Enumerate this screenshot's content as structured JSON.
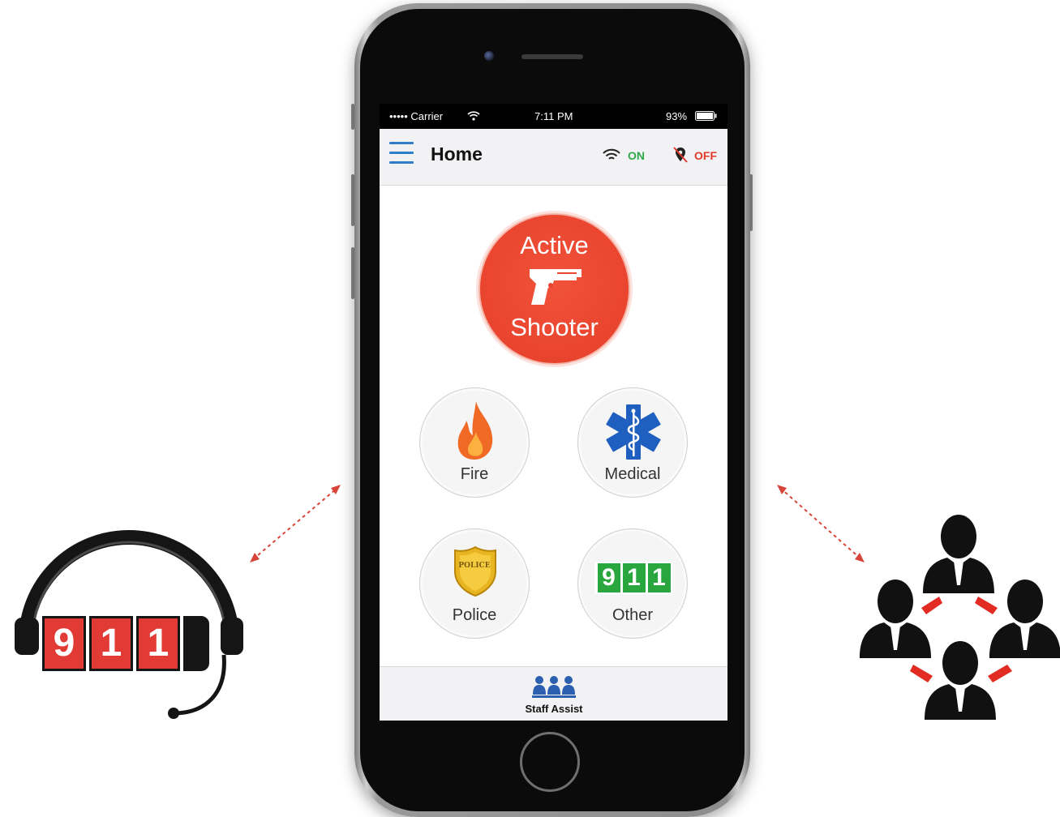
{
  "status_bar": {
    "carrier": "••••• Carrier",
    "time": "7:11 PM",
    "battery": "93%"
  },
  "nav": {
    "title": "Home",
    "wifi_label": "ON",
    "location_label": "OFF",
    "icons": {
      "menu": "menu-icon",
      "wifi": "wifi-icon",
      "location": "location-off-icon"
    }
  },
  "buttons": {
    "active_shooter": {
      "line1": "Active",
      "line2": "Shooter",
      "icon": "gun-icon"
    },
    "fire": {
      "label": "Fire",
      "icon": "flame-icon"
    },
    "medical": {
      "label": "Medical",
      "icon": "star-of-life-icon"
    },
    "police": {
      "label": "Police",
      "icon": "police-badge-icon",
      "badge_text": "POLICE"
    },
    "other": {
      "label": "Other",
      "icon": "911-icon",
      "digits": [
        "9",
        "1",
        "1"
      ]
    }
  },
  "bottom_bar": {
    "staff_assist_label": "Staff Assist",
    "icon": "staff-group-icon"
  },
  "illustrations": {
    "dispatcher_digits": [
      "9",
      "1",
      "1"
    ],
    "dispatcher_icon": "headset-911-icon",
    "staff_network_icon": "staff-network-icon"
  },
  "colors": {
    "accent_blue": "#2f7fc8",
    "alert_red": "#e9452f",
    "on_green": "#2fa84a",
    "off_red": "#e23a2a",
    "tile_red": "#e23a34",
    "tile_green": "#2aa63f"
  }
}
